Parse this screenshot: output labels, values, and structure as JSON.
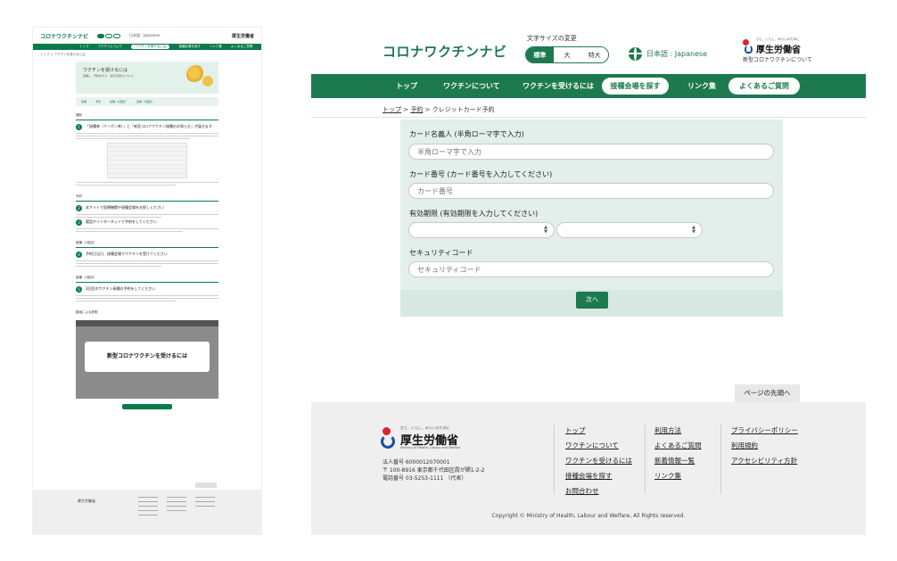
{
  "thumbnail": {
    "site_title": "コロナワクチンナビ",
    "hero_title": "ワクチンを受けるには",
    "video_caption": "新型コロナワクチンを受けるには"
  },
  "header": {
    "site_title": "コロナワクチンナビ",
    "font_size_label": "文字サイズの変更",
    "font_sizes": [
      "標準",
      "大",
      "特大"
    ],
    "font_size_selected": "標準",
    "language": "日本語 : Japanese",
    "logo_small": "ひと、くらし、みらいのために",
    "logo_name": "厚生労働省",
    "logo_tagline": "新型コロナワクチンについて"
  },
  "nav": {
    "items": [
      "トップ",
      "ワクチンについて",
      "ワクチンを受けるには",
      "接種会場を探す",
      "リンク集",
      "よくあるご質問"
    ]
  },
  "breadcrumb": {
    "top": "トップ",
    "sep1": " > ",
    "reserve": "予約",
    "sep2": " > ",
    "current": "クレジットカード予約"
  },
  "form": {
    "name_label": "カード名義人 (半角ローマ字で入力)",
    "name_placeholder": "半角ローマ字で入力",
    "number_label": "カード番号 (カード番号を入力してください)",
    "number_placeholder": "カード番号",
    "expiry_label": "有効期限 (有効期限を入力してください)",
    "expiry_month": "",
    "expiry_year": "",
    "security_label": "セキュリティコード",
    "security_placeholder": "セキュリティコード",
    "next_label": "次へ"
  },
  "page_top_label": "ページの先頭へ",
  "footer": {
    "logo_small": "ひと、くらし、みらいのために",
    "logo_name": "厚生労働省",
    "logo_en": "Ministry of Health, Labour and Welfare",
    "corp_number": "法人番号 6000012070001",
    "address": "〒 100-8916 東京都千代田区霞が関1-2-2",
    "phone": "電話番号 03-5253-1111 （代表）",
    "col1": [
      "トップ",
      "ワクチンについて",
      "ワクチンを受けるには",
      "接種会場を探す",
      "お問合わせ"
    ],
    "col2": [
      "利用方法",
      "よくあるご質問",
      "新着情報一覧",
      "リンク集"
    ],
    "col3": [
      "プライバシーポリシー",
      "利用規約",
      "アクセシビリティ方針"
    ],
    "copyright": "Copyright © Ministry of Health, Labour and Welfare, All Rights reserved."
  },
  "colors": {
    "brand_green": "#1d7a4e",
    "form_bg": "#e2efea",
    "footer_bg": "#efefef"
  }
}
